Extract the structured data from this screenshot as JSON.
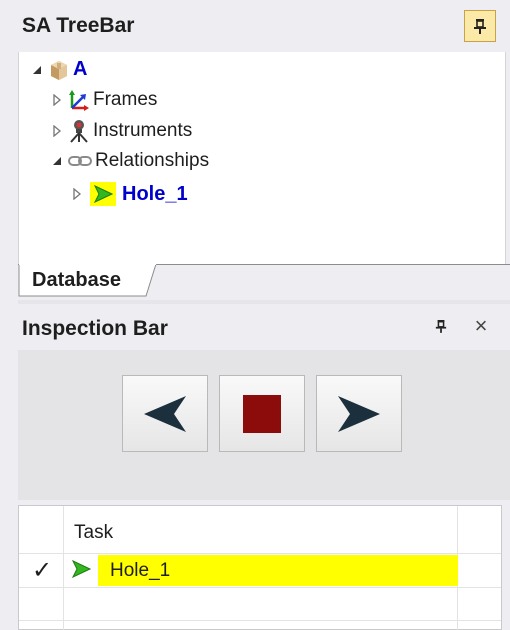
{
  "tree_bar": {
    "title": "SA TreeBar",
    "root": {
      "label": "A",
      "icon": "box-icon"
    },
    "children": [
      {
        "label": "Frames",
        "icon": "axes-icon"
      },
      {
        "label": "Instruments",
        "icon": "tripod-icon"
      },
      {
        "label": "Relationships",
        "icon": "chain-link-icon"
      }
    ],
    "relationship_item": {
      "label": "Hole_1",
      "icon": "green-arrow-icon"
    },
    "tab_label": "Database"
  },
  "inspection_bar": {
    "title": "Inspection Bar",
    "close_glyph": "×",
    "buttons": [
      "previous",
      "stop",
      "next"
    ],
    "table": {
      "header": "Task",
      "rows": [
        {
          "label": "Hole_1",
          "checked": true,
          "check_glyph": "✓"
        }
      ]
    }
  },
  "colors": {
    "highlight": "#ffff00",
    "link_blue": "#0000cc",
    "stop_red": "#8c0b0b",
    "arrow_green": "#32b81e"
  }
}
